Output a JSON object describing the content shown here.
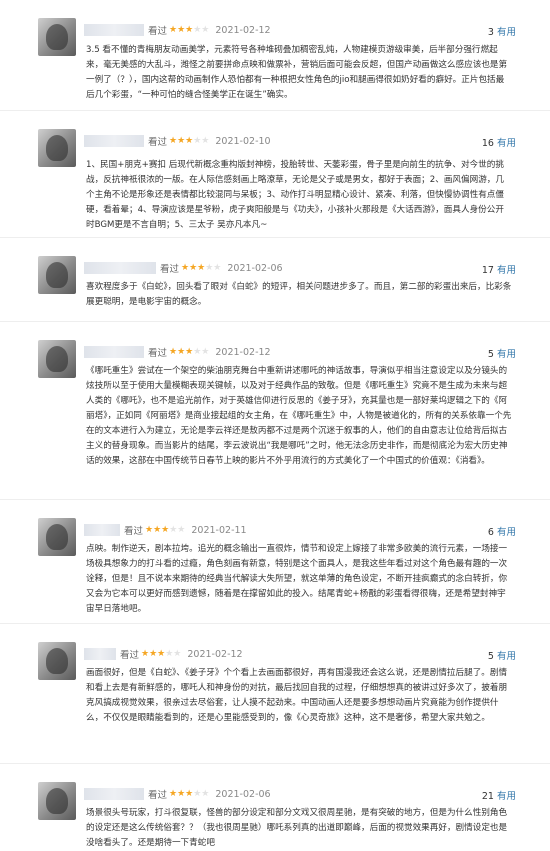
{
  "reviews": [
    {
      "status": "看过",
      "rating": 3,
      "date": "2021-02-12",
      "useful_count": "3",
      "useful_label": "有用",
      "text": "3.5 看不懂的青梅朋友动画美学，元素符号各种堆砌叠加稠密乱炖，人物建模页游级审美，后半部分强行燃起来，毫无美感的大乱斗，潍怪之前要拼命点映和做票补，营销后面可能会反超，但国产动画做这么感应该也是第一例了（？），国内这帮的动画制作人恐怕都有一种根把女性角色的jio和腿画得很如奶好看的癖好。正片包括最后几个彩蛋，“一种可怕的缝合怪美学正在诞生”确实。"
    },
    {
      "status": "看过",
      "rating": 3,
      "date": "2021-02-10",
      "useful_count": "16",
      "useful_label": "有用",
      "text": "1、民国+朋克+赛扣 后现代新概念重构版封神榜，投胎转世、天萎彩蛋，骨子里是向前生的抗争、对今世的挑战，反抗神祇很浓的一版。在人际信感刻画上略潦草，无论是父子或是男女，都好于表面；2、画风偏网游，几个主角不论是形象还是表情都比较混同与呆板；3、动作打斗明显精心设计、紧凑、利落，但快慢协调性有点僵硬，看着晕；4、导演应该是星爷粉，虎子爽阳般是与《功夫》，小孩补火那段是《大话西游》，面具人身份公开时BGM更是不言自明；5、三太子 吴亦凡本凡~"
    },
    {
      "status": "看过",
      "rating": 3,
      "date": "2021-02-06",
      "useful_count": "17",
      "useful_label": "有用",
      "text": "喜欢程度多于《白蛇》，回头看了眼对《白蛇》的短评，相关问题进步多了。而且，第二部的彩蛋出来后，比彩条展更聪明，是电影宇宙的概念。"
    },
    {
      "status": "看过",
      "rating": 3,
      "date": "2021-02-12",
      "useful_count": "5",
      "useful_label": "有用",
      "text": "《哪吒重生》尝试在一个架空的柴油朋克舞台中重新讲述哪吒的神话故事，导演似乎相当注意设定以及分镜头的炫技所以至于使用大量模糊表现关键帧，以及对于经典作品的致敬。但是《哪吒重生》究竟不是生成为未来与超人类的《哪吒》，也不是追光前作，对于英雄信仰进行反思的《姜子牙》，充其量也是一部好莱坞逻辑之下的《阿丽塔》，正如同《阿丽塔》是商业接起组的女主角，在《哪吒重生》中，人物是被道化的，所有的关系依靠一个先在的文本进行入为建立，无论是李云祥还是敖丙都不过是两个沉迷于叙事的人，他们的自由意志让位给背后拟古主义的替身现象。而当影片的结尾，李云波说出“我是哪吒”之时，他无法念历史非作，而是彻底沦为宏大历史神话的效果，这部在中国传统节日春节上映的影片不外乎用流行的方式美化了一个中国式的价值观：《消看》。"
    },
    {
      "status": "看过",
      "rating": 3,
      "date": "2021-02-11",
      "useful_count": "6",
      "useful_label": "有用",
      "text": "点映。制作逆天，剧本拉垮。追光的概念输出一直很炸，情节和设定上嫁接了非常多欧美的流行元素，一场接一场极具想象力的打斗看的过瘾，角色刻画有新意，特别是这个面具人，是我这些年看过对这个角色最有趣的一次诠释，但是！且不说本来期待的经典当代解读大失所望，就这单薄的角色设定，不断开挂疯癫式的念白转折，你又会为它本可以更好而感到遗憾，随着是在撑留如此的投入。结尾青蛇+杨戬的彩蛋看得很嗨，还是希望封神宇宙早日落地吧。"
    },
    {
      "status": "看过",
      "rating": 3,
      "date": "2021-02-12",
      "useful_count": "5",
      "useful_label": "有用",
      "text": "画面很好，但是《白蛇》、《姜子牙》个个看上去画面都很好，再有国漫我还会这么说，还是剧情拉后腿了。剧情和看上去是有新鲜感的，哪吒人和神身份的对抗，最后找回自我的过程，仔细想想真的被讲过好多次了，披着朋克风搞成视觉效果，很亲过去尽俗套，让人摸不起劲来。中国动画人还是要多想想动画片究竟能为创作提供什么，不仅仅是眼睛能看到的，还是心里能感受到的，像《心灵奇旅》这种，这不是奢侈，希望大家共勉之。"
    },
    {
      "status": "看过",
      "rating": 3,
      "date": "2021-02-06",
      "useful_count": "21",
      "useful_label": "有用",
      "text": "场景很头号玩家，打斗很复联，怪兽的部分设定和部分文戏又很周星驰，是有突破的地方，但是为什么性别角色的设定还是这么传统俗套？？（我也很周星驰）哪吒系列真的出道即巅峰，后面的视觉效果再好，剧情设定也是没啥看头了。还是期待一下青蛇吧"
    }
  ]
}
